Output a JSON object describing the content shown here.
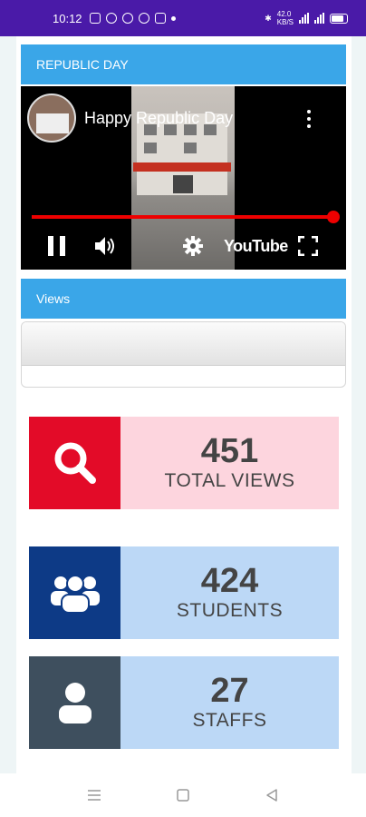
{
  "status_bar": {
    "time": "10:12",
    "speed": "42.0",
    "speed_unit": "KB/S"
  },
  "colors": {
    "status_bar_bg": "#4a1aa8",
    "header_blue": "#3aa6e8",
    "views_red": "#e30b28",
    "views_pink": "#fdd5de",
    "students_navy": "#0d3a86",
    "students_light": "#bcd8f6",
    "staffs_slate": "#3e4f5e",
    "staffs_light": "#bcd8f6",
    "youtube_red": "#e00000"
  },
  "republic_section": {
    "header": "REPUBLIC DAY",
    "video": {
      "title": "Happy Republic Day",
      "brand": "YouTube",
      "progress": 1.0,
      "controls": [
        "pause-icon",
        "volume-icon",
        "settings-gear-icon",
        "fullscreen-icon",
        "more-vertical-icon"
      ]
    }
  },
  "views_section": {
    "header": "Views"
  },
  "stats": [
    {
      "value": "451",
      "label": "TOTAL VIEWS",
      "icon": "search-icon"
    },
    {
      "value": "424",
      "label": "STUDENTS",
      "icon": "group-icon"
    },
    {
      "value": "27",
      "label": "STAFFS",
      "icon": "person-icon"
    }
  ],
  "nav_bar": {
    "buttons": [
      "menu-icon",
      "home-square-icon",
      "back-triangle-icon"
    ]
  }
}
